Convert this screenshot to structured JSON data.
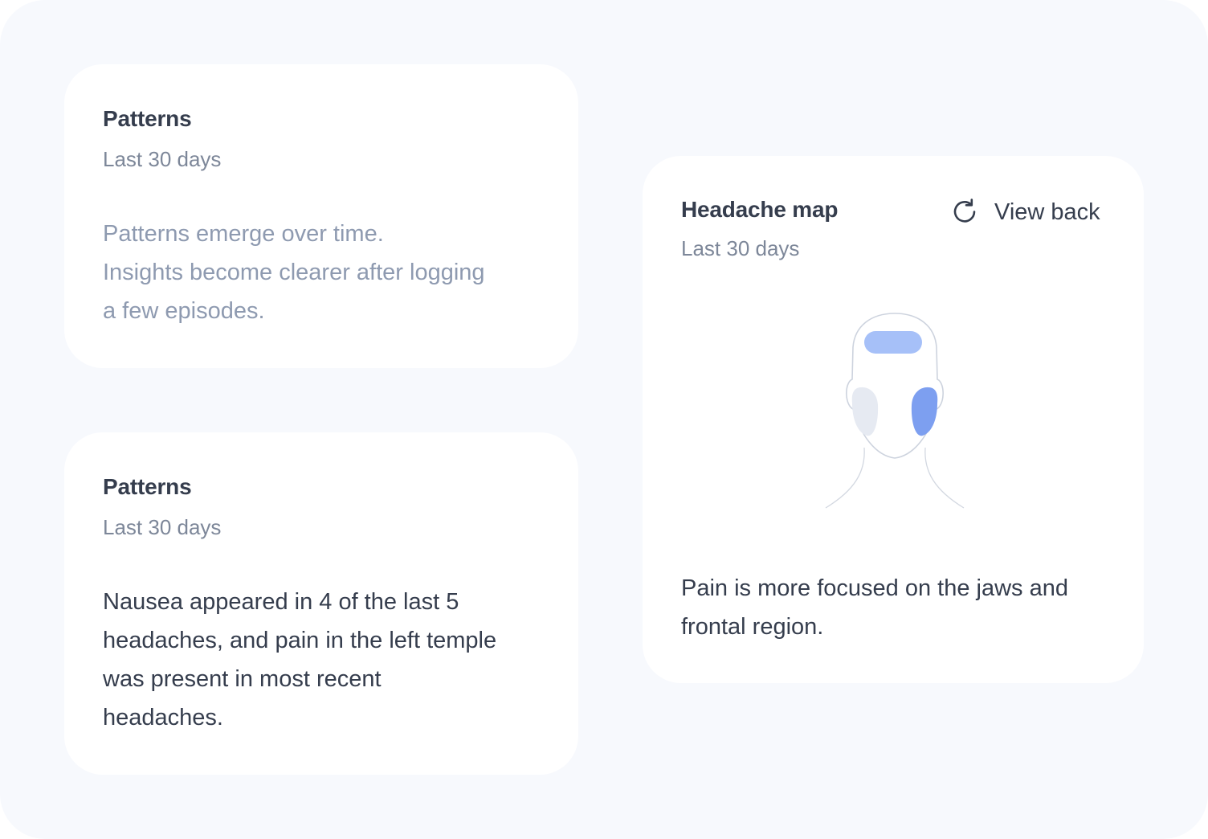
{
  "cards": {
    "patterns_empty": {
      "title": "Patterns",
      "subtitle": "Last 30 days",
      "lines": [
        "Patterns emerge over time.",
        "Insights become clearer after logging",
        "a few episodes."
      ]
    },
    "patterns_insight": {
      "title": "Patterns",
      "subtitle": "Last 30 days",
      "lines": [
        "Nausea appeared in 4 of the last 5",
        "headaches, and pain in the left temple",
        "was present in most recent",
        "headaches."
      ]
    },
    "headache_map": {
      "title": "Headache map",
      "subtitle": "Last 30 days",
      "action_label": "View back",
      "action_icon": "rotate-icon",
      "regions": {
        "frontal": {
          "color": "#a6c0f8"
        },
        "jaw_right_side": {
          "color": "#7d9ff0"
        },
        "jaw_left_side": {
          "color": "#e6eaf2"
        }
      },
      "lines": [
        "Pain is more focused on the jaws and",
        "frontal region."
      ]
    }
  }
}
